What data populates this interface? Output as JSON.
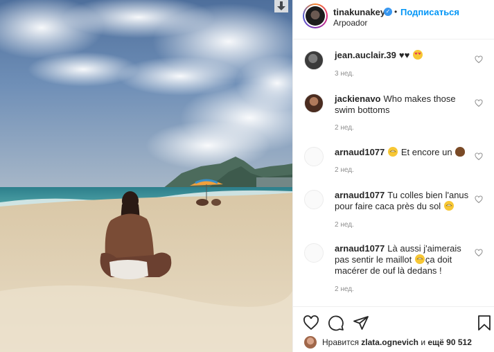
{
  "post": {
    "username": "tinakunakey",
    "verified": true,
    "follow_label": "Подписаться",
    "separator": "•",
    "location": "Arpoador"
  },
  "comments": [
    {
      "user": "jean.auclair.39",
      "text": "♥♥",
      "emojis": [
        "heart-eyes-emoji"
      ],
      "time": "3 нед."
    },
    {
      "user": "jackienavo",
      "text": "Who makes those swim bottoms",
      "emojis": [],
      "time": "2 нед."
    },
    {
      "user": "arnaud1077",
      "text": "Et encore un",
      "lead_emoji": "grin-sweat-emoji",
      "emojis": [
        "poop-emoji"
      ],
      "time": "2 нед."
    },
    {
      "user": "arnaud1077",
      "text": "Tu colles bien l'anus pour faire caca près du sol",
      "emojis": [
        "grin-sweat-emoji"
      ],
      "time": "2 нед."
    },
    {
      "user": "arnaud1077",
      "text_a": "Là aussi j'aimerais pas sentir le maillot",
      "text_b": "ça doit macérer de ouf là dedans !",
      "emojis": [
        "grin-sweat-emoji"
      ],
      "time": "2 нед."
    }
  ],
  "actions": {
    "icons": [
      "heart-icon",
      "comment-icon",
      "share-icon",
      "bookmark-icon"
    ]
  },
  "likes": {
    "prefix": "Нравится",
    "user": "zlata.ognevich",
    "middle": "и",
    "count_text": "ещё 90 512"
  },
  "colors": {
    "link_blue": "#0095f6",
    "verified_blue": "#3897f0",
    "muted": "#8e8e8e",
    "border": "#efefef"
  }
}
